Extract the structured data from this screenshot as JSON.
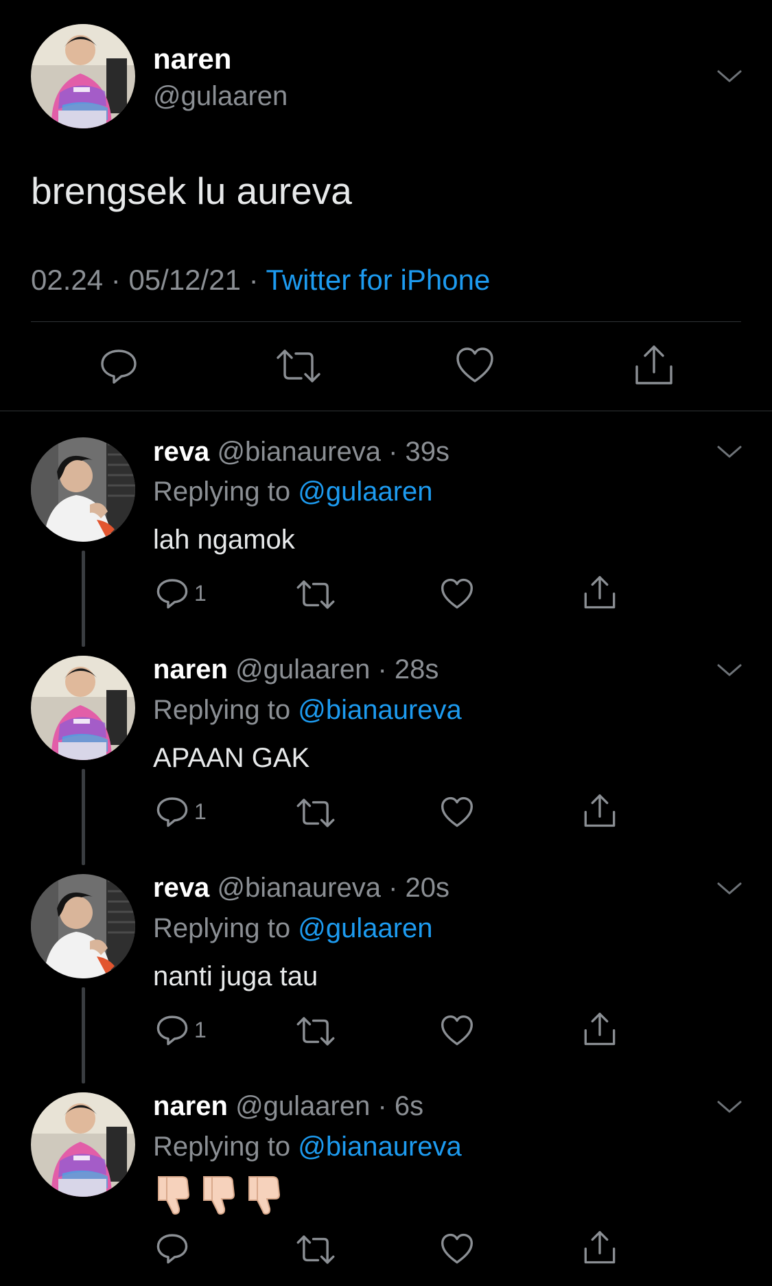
{
  "main_tweet": {
    "name": "naren",
    "handle": "@gulaaren",
    "text": "brengsek lu aureva",
    "time": "02.24",
    "date": "05/12/21",
    "source": "Twitter for iPhone"
  },
  "replies": [
    {
      "name": "reva",
      "handle": "@bianaureva",
      "age": "39s",
      "replying_prefix": "Replying to",
      "replying_to": "@gulaaren",
      "text": "lah ngamok",
      "reply_count": "1"
    },
    {
      "name": "naren",
      "handle": "@gulaaren",
      "age": "28s",
      "replying_prefix": "Replying to",
      "replying_to": "@bianaureva",
      "text": "APAAN GAK",
      "reply_count": "1"
    },
    {
      "name": "reva",
      "handle": "@bianaureva",
      "age": "20s",
      "replying_prefix": "Replying to",
      "replying_to": "@gulaaren",
      "text": "nanti juga tau",
      "reply_count": "1"
    },
    {
      "name": "naren",
      "handle": "@gulaaren",
      "age": "6s",
      "replying_prefix": "Replying to",
      "replying_to": "@bianaureva",
      "text": "",
      "emojis": [
        "thumbs-down",
        "thumbs-down",
        "thumbs-down"
      ],
      "reply_count": ""
    }
  ],
  "separator": " · ",
  "colors": {
    "background": "#000000",
    "accent": "#1d9bf0",
    "muted": "#8b8f94"
  }
}
